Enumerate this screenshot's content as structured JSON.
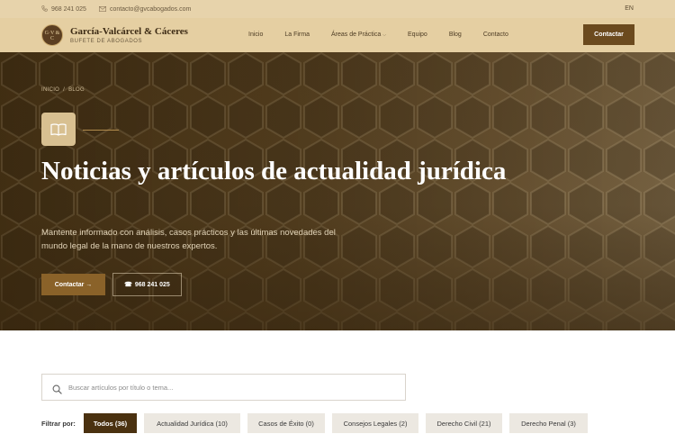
{
  "topbar": {
    "phone": "968 241 025",
    "email": "contacto@gvcabogados.com",
    "language": "EN"
  },
  "header": {
    "logo_text": "G·V & C",
    "brand_name": "García-Valcárcel & Cáceres",
    "brand_sub": "BUFETE DE ABOGADOS",
    "nav": [
      {
        "label": "Inicio"
      },
      {
        "label": "La Firma"
      },
      {
        "label": "Áreas de Práctica",
        "dropdown": true
      },
      {
        "label": "Equipo"
      },
      {
        "label": "Blog"
      },
      {
        "label": "Contacto"
      }
    ],
    "cta_label": "Contactar"
  },
  "hero": {
    "breadcrumb": [
      "INICIO",
      "BLOG"
    ],
    "icon": "book-icon",
    "title": "Noticias y artículos de actualidad jurídica",
    "description": "Mantente informado con análisis, casos prácticos y las últimas novedades del mundo legal de la mano de nuestros expertos.",
    "cta_label": "Contactar →",
    "phone_label": "968 241 025"
  },
  "search": {
    "placeholder": "Buscar artículos por título o tema...",
    "value": ""
  },
  "filters": {
    "label": "Filtrar por:",
    "options": [
      {
        "label": "Todos (36)",
        "active": true
      },
      {
        "label": "Actualidad Jurídica (10)",
        "active": false
      },
      {
        "label": "Casos de Éxito (0)",
        "active": false
      },
      {
        "label": "Consejos Legales (2)",
        "active": false
      },
      {
        "label": "Derecho Civil (21)",
        "active": false
      },
      {
        "label": "Derecho Penal (3)",
        "active": false
      }
    ]
  },
  "colors": {
    "accent_dark": "#4a3110",
    "accent_brown": "#6b4a1e",
    "header_bg": "#e5cfa2"
  }
}
